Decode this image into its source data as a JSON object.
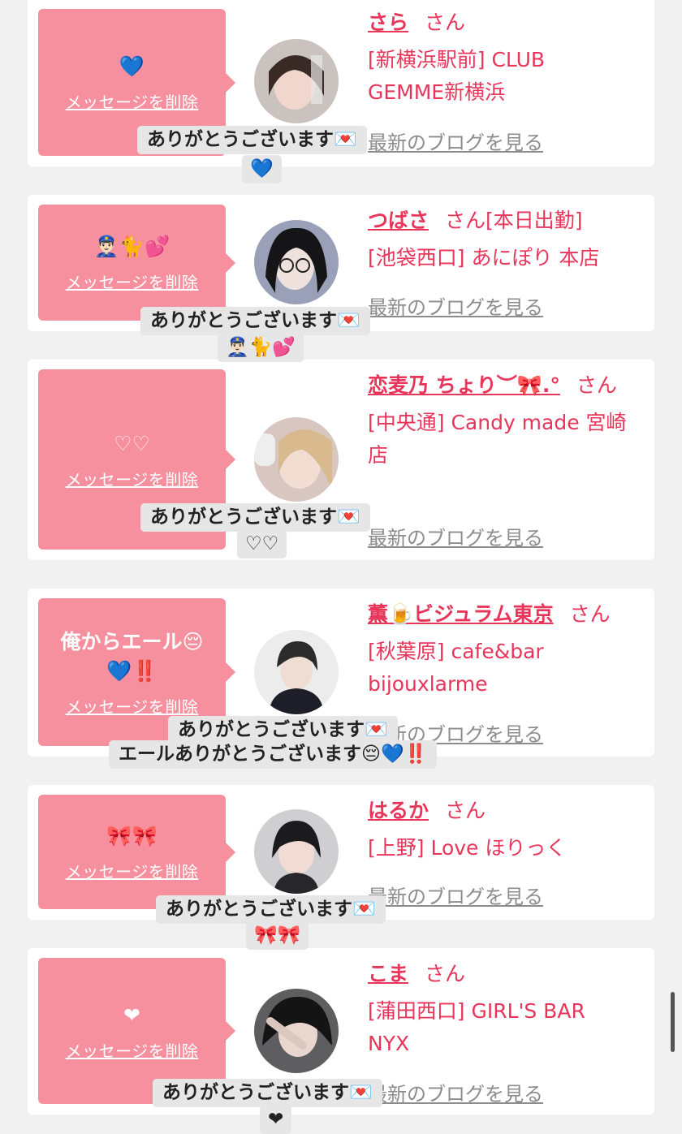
{
  "common": {
    "delete_label": "メッセージを削除",
    "blog_label": "最新のブログを見る",
    "san": "さん",
    "thanks": "ありがとうございます💌"
  },
  "cards": [
    {
      "message": "💙",
      "name": "さら",
      "status": "",
      "shop": "[新横浜駅前] CLUB GEMME新横浜",
      "reply_emoji": "💙"
    },
    {
      "message": "👮🏻‍♂️🐈💕",
      "name": "つばさ",
      "status": "[本日出勤]",
      "shop": "[池袋西口] あにぽり 本店",
      "reply_emoji": "👮🏻‍♂️🐈💕"
    },
    {
      "message": "♡♡",
      "name": "恋麦乃 ちょり︶🎀.°",
      "status": "",
      "shop": "[中央通] Candy made 宮崎店",
      "reply_emoji": "♡♡"
    },
    {
      "message": "俺からエール😔💙‼️",
      "name": "薫🍺ビジュラム東京",
      "status": "",
      "shop": "[秋葉原] cafe&bar bijouxlarme",
      "reply_emoji": "エールありがとうございます😔💙‼️"
    },
    {
      "message": "🎀🎀",
      "name": "はるか",
      "status": "",
      "shop": "[上野] Love ほりっく",
      "reply_emoji": "🎀🎀"
    },
    {
      "message": "❤",
      "name": "こま",
      "status": "",
      "shop": "[蒲田西口] GIRL'S BAR NYX",
      "reply_emoji": "❤"
    }
  ]
}
